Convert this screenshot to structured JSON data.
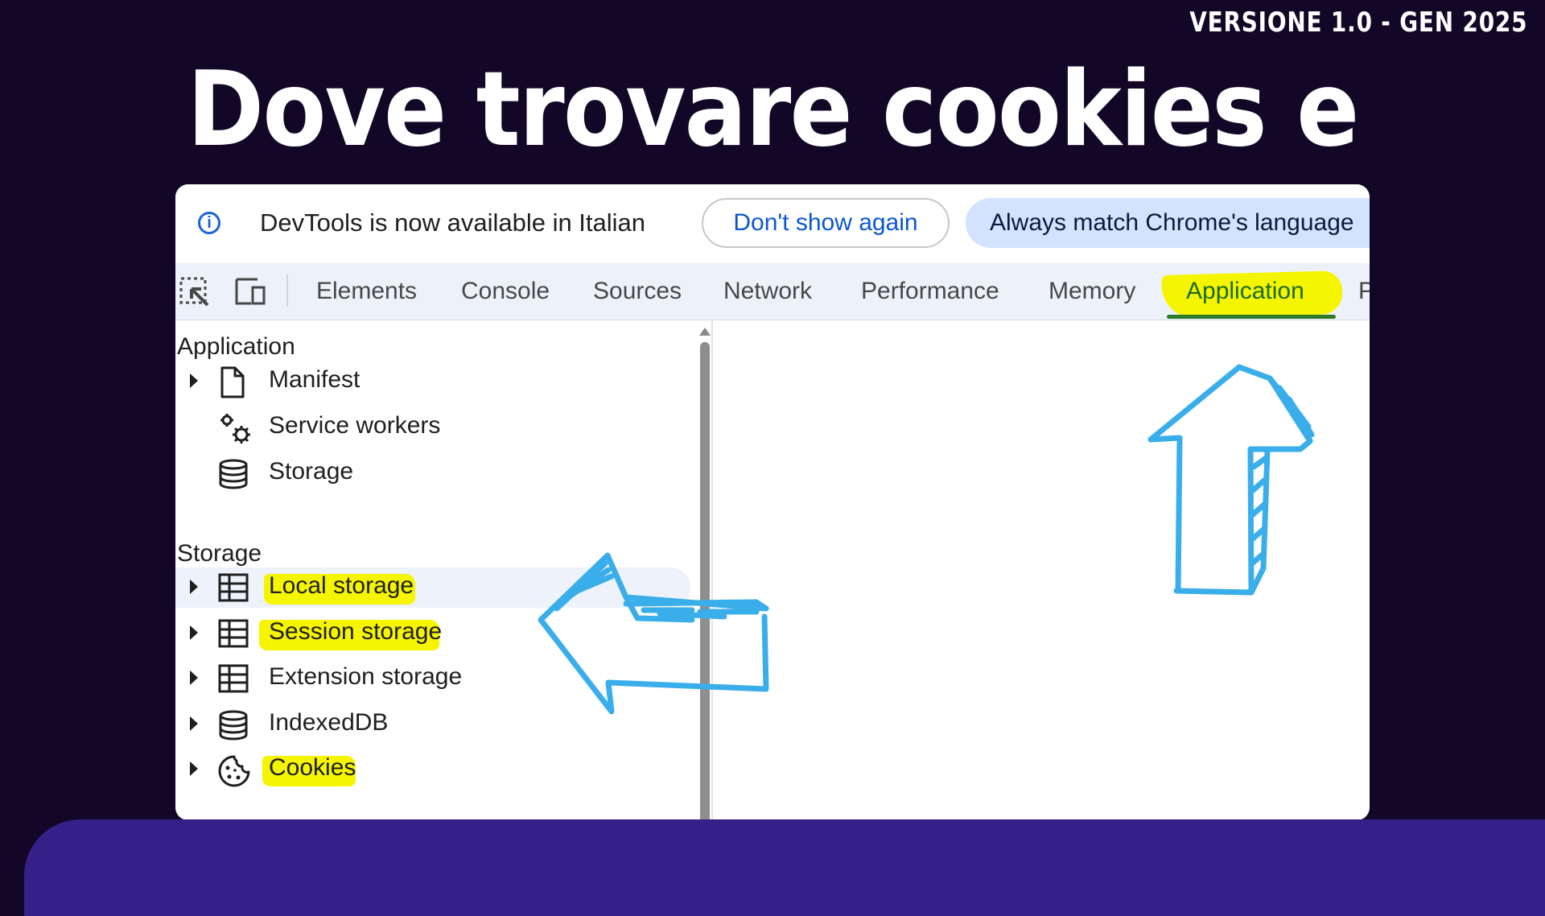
{
  "header": {
    "version": "VERSIONE 1.0 - GEN 2025",
    "title": "Dove trovare cookies e storage"
  },
  "infobar": {
    "message": "DevTools is now available in Italian",
    "dont_show_label": "Don't show again",
    "always_match_label": "Always match Chrome's language"
  },
  "tabs": {
    "items": [
      {
        "label": "Elements"
      },
      {
        "label": "Console"
      },
      {
        "label": "Sources"
      },
      {
        "label": "Network"
      },
      {
        "label": "Performance"
      },
      {
        "label": "Memory"
      },
      {
        "label": "Application",
        "active": true
      },
      {
        "label": "P"
      }
    ]
  },
  "sidebar": {
    "application_heading": "Application",
    "application_items": [
      {
        "label": "Manifest",
        "icon": "file-icon",
        "expandable": true
      },
      {
        "label": "Service workers",
        "icon": "gears-icon",
        "expandable": false
      },
      {
        "label": "Storage",
        "icon": "database-icon",
        "expandable": false
      }
    ],
    "storage_heading": "Storage",
    "storage_items": [
      {
        "label": "Local storage",
        "icon": "table-icon",
        "expandable": true,
        "highlighted": true,
        "selected": true
      },
      {
        "label": "Session storage",
        "icon": "table-icon",
        "expandable": true,
        "highlighted": true
      },
      {
        "label": "Extension storage",
        "icon": "table-icon",
        "expandable": true
      },
      {
        "label": "IndexedDB",
        "icon": "database-icon",
        "expandable": true
      },
      {
        "label": "Cookies",
        "icon": "cookie-icon",
        "expandable": true,
        "highlighted": true
      }
    ]
  },
  "colors": {
    "background": "#120727",
    "band": "#35208a",
    "highlight": "#f5f500",
    "arrow": "#3aaeea",
    "link_blue": "#0b57d0"
  }
}
